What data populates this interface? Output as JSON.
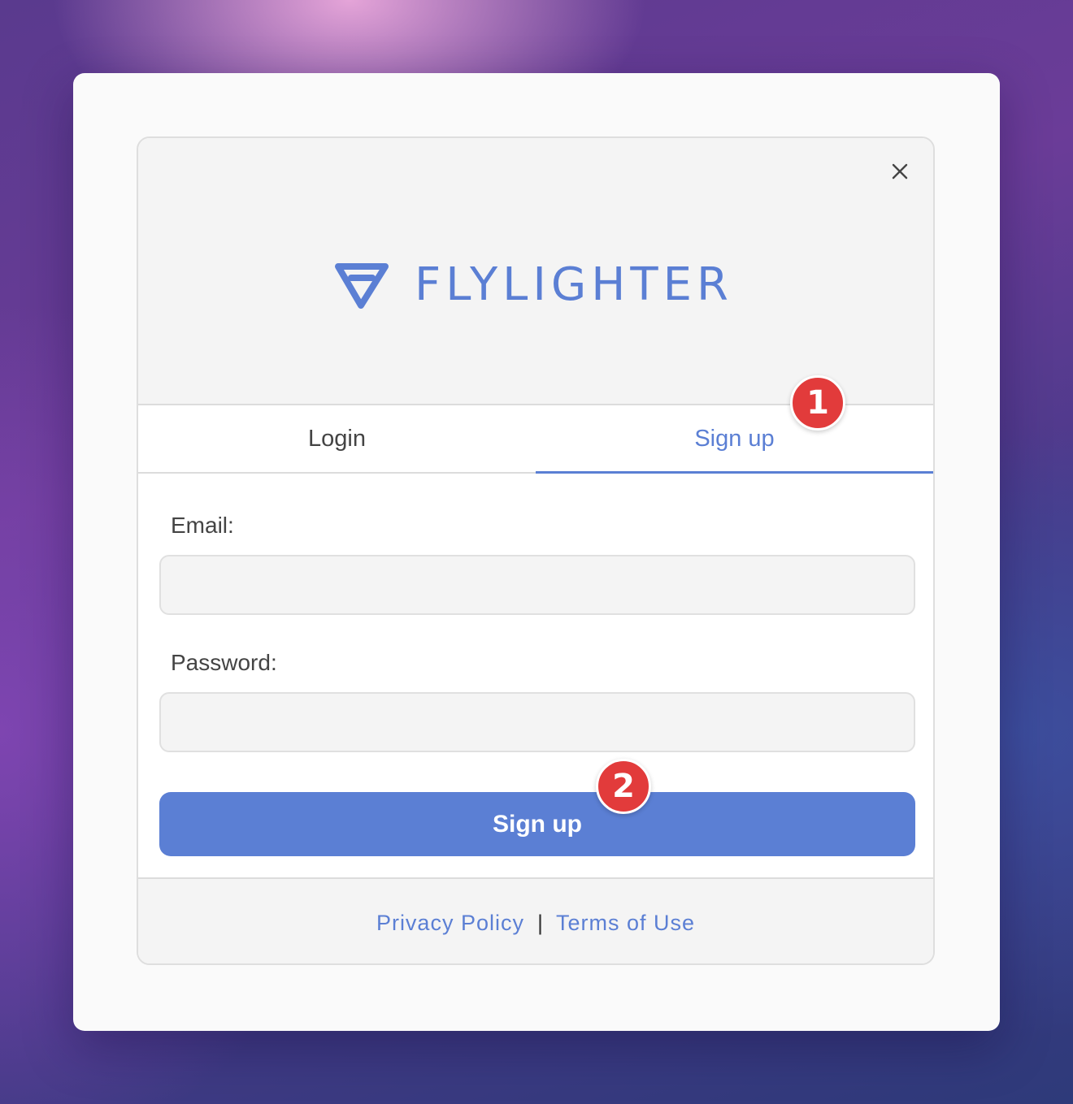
{
  "brand": {
    "name": "FLYLIGHTER",
    "color": "#5b7fd4"
  },
  "header": {
    "close_icon": "close-icon"
  },
  "tabs": [
    {
      "label": "Login",
      "active": false
    },
    {
      "label": "Sign up",
      "active": true
    }
  ],
  "form": {
    "email_label": "Email:",
    "email_value": "",
    "password_label": "Password:",
    "password_value": "",
    "submit_label": "Sign up"
  },
  "footer": {
    "privacy_label": "Privacy Policy",
    "separator": "|",
    "terms_label": "Terms of Use"
  },
  "annotations": [
    {
      "label": "1",
      "color": "#e23b3b"
    },
    {
      "label": "2",
      "color": "#e23b3b"
    }
  ]
}
